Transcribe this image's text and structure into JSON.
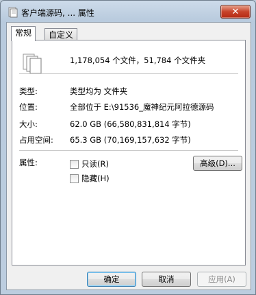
{
  "window": {
    "title": "客户端源码, ... 属性",
    "close_label": "✕"
  },
  "tabs": [
    {
      "label": "常规",
      "active": true
    },
    {
      "label": "自定义",
      "active": false
    }
  ],
  "general": {
    "summary": "1,178,054 个文件，51,784 个文件夹",
    "type_label": "类型:",
    "type_value": "类型均为 文件夹",
    "location_label": "位置:",
    "location_value": "全部位于 E:\\91536_魔神纪元阿拉德源码",
    "size_label": "大小:",
    "size_value": "62.0 GB (66,580,831,814 字节)",
    "disk_size_label": "占用空间:",
    "disk_size_value": "65.3 GB (70,169,157,632 字节)",
    "attributes_label": "属性:",
    "readonly_label": "只读(R)",
    "readonly_checked": false,
    "hidden_label": "隐藏(H)",
    "hidden_checked": false,
    "advanced_label": "高级(D)..."
  },
  "buttons": {
    "ok": "确定",
    "cancel": "取消",
    "apply": "应用(A)"
  },
  "colors": {
    "titlebar": "#c5d5e6",
    "close_button": "#c7432a",
    "panel": "#ffffff",
    "dialog_bg": "#f0f0f0"
  }
}
